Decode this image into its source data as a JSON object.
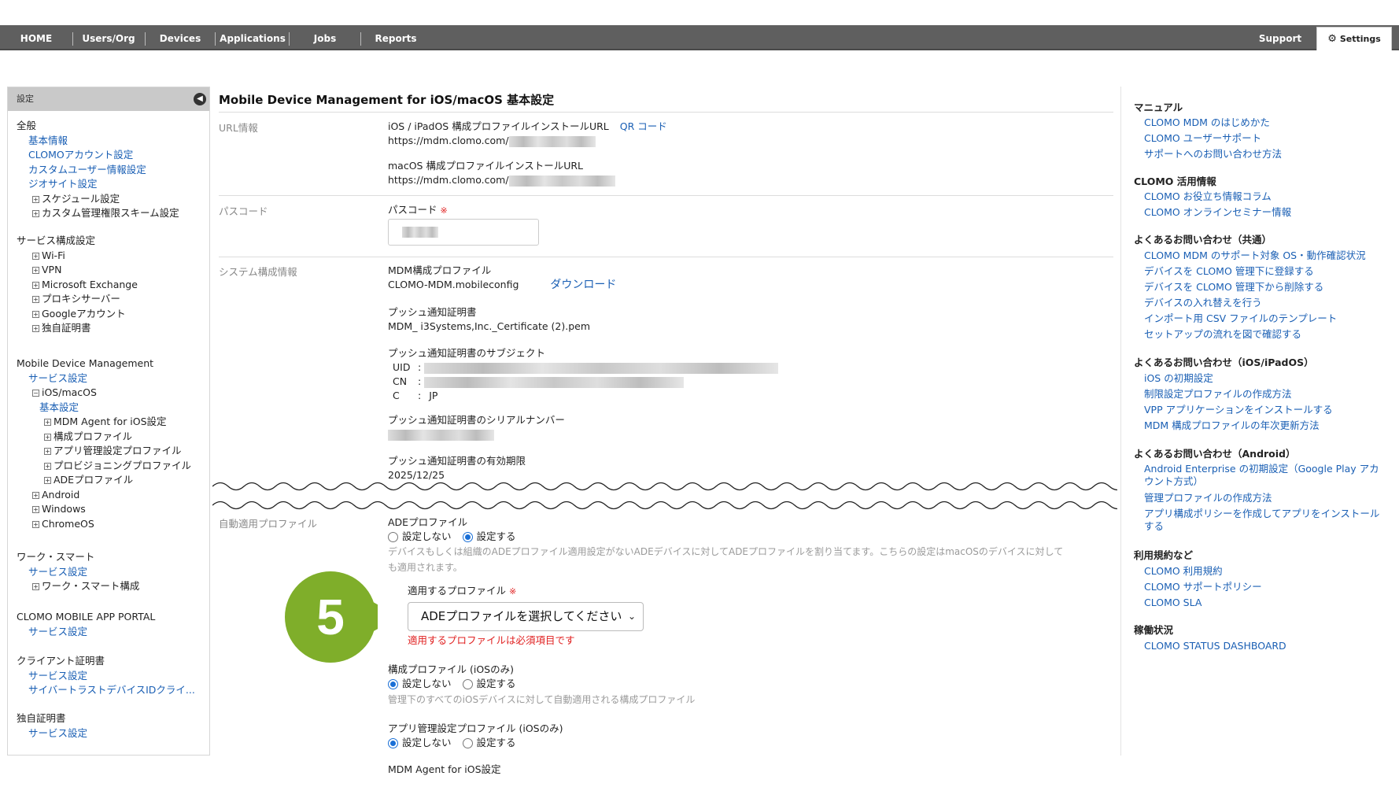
{
  "topnav": {
    "items": [
      "HOME",
      "Users/Org",
      "Devices",
      "Applications",
      "Jobs",
      "Reports"
    ],
    "support": "Support",
    "settings": "Settings"
  },
  "sidebar": {
    "header": "設定",
    "general": {
      "title": "全般",
      "links": [
        "基本情報",
        "CLOMOアカウント設定",
        "カスタムユーザー情報設定",
        "ジオサイト設定"
      ],
      "tree": [
        "スケジュール設定",
        "カスタム管理権限スキーム設定"
      ]
    },
    "service": {
      "title": "サービス構成設定",
      "tree": [
        "Wi-Fi",
        "VPN",
        "Microsoft Exchange",
        "プロキシサーバー",
        "Googleアカウント",
        "独自証明書"
      ]
    },
    "mdm": {
      "title": "Mobile Device Management",
      "service_link": "サービス設定",
      "ios": "iOS/macOS",
      "basic": "基本設定",
      "ios_children": [
        "MDM Agent for iOS設定",
        "構成プロファイル",
        "アプリ管理設定プロファイル",
        "プロビジョニングプロファイル",
        "ADEプロファイル"
      ],
      "others": [
        "Android",
        "Windows",
        "ChromeOS"
      ]
    },
    "work": {
      "title": "ワーク・スマート",
      "link": "サービス設定",
      "tree": "ワーク・スマート構成"
    },
    "portal": {
      "title": "CLOMO MOBILE APP PORTAL",
      "link": "サービス設定"
    },
    "client_cert": {
      "title": "クライアント証明書",
      "links": [
        "サービス設定",
        "サイバートラストデバイスIDクライ..."
      ]
    },
    "own_cert": {
      "title": "独自証明書",
      "link": "サービス設定"
    }
  },
  "main": {
    "title": "Mobile Device Management for iOS/macOS 基本設定",
    "url": {
      "label": "URL情報",
      "ios_title": "iOS / iPadOS 構成プロファイルインストールURL",
      "qr": "QR コード",
      "ios_url": "https://mdm.clomo.com/",
      "mac_title": "macOS 構成プロファイルインストールURL",
      "mac_url": "https://mdm.clomo.com/"
    },
    "passcode": {
      "label": "パスコード",
      "field_label": "パスコード",
      "required": "※"
    },
    "system": {
      "label": "システム構成情報",
      "mdm_profile": "MDM構成プロファイル",
      "mdm_file": "CLOMO-MDM.mobileconfig",
      "download": "ダウンロード",
      "push_cert": "プッシュ通知証明書",
      "push_file": "MDM_ i3Systems,Inc._Certificate (2).pem",
      "subject": "プッシュ通知証明書のサブジェクト",
      "uid": "UID",
      "cn": "CN",
      "c": "C",
      "c_val": "JP",
      "serial": "プッシュ通知証明書のシリアルナンバー",
      "expiry": "プッシュ通知証明書の有効期限",
      "expiry_val": "2025/12/25"
    },
    "auto": {
      "label": "自動適用プロファイル",
      "ade_title": "ADEプロファイル",
      "no": "設定しない",
      "yes": "設定する",
      "ade_help_1": "デバイスもしくは組織のADEプロファイル適用設定がないADEデバイスに対してADEプロファイルを割り当てます。こちらの設定はmacOSのデバイスに対して",
      "ade_help_2": "も適用されます。",
      "apply_label": "適用するプロファイル",
      "required": "※",
      "select_value": "ADEプロファイルを選択してください",
      "error": "適用するプロファイルは必須項目です",
      "config_title": "構成プロファイル (iOSのみ)",
      "config_help": "管理下のすべてのiOSデバイスに対して自動適用される構成プロファイル",
      "app_title": "アプリ管理設定プロファイル (iOSのみ)",
      "agent_title": "MDM Agent for iOS設定"
    },
    "step_number": "5"
  },
  "rightbar": {
    "manual": {
      "title": "マニュアル",
      "links": [
        "CLOMO MDM のはじめかた",
        "CLOMO ユーザーサポート",
        "サポートへのお問い合わせ方法"
      ]
    },
    "usage": {
      "title": "CLOMO 活用情報",
      "links": [
        "CLOMO お役立ち情報コラム",
        "CLOMO オンラインセミナー情報"
      ]
    },
    "faq_common": {
      "title": "よくあるお問い合わせ（共通）",
      "links": [
        "CLOMO MDM のサポート対象 OS・動作確認状況",
        "デバイスを CLOMO 管理下に登録する",
        "デバイスを CLOMO 管理下から削除する",
        "デバイスの入れ替えを行う",
        "インポート用 CSV ファイルのテンプレート",
        "セットアップの流れを図で確認する"
      ]
    },
    "faq_ios": {
      "title": "よくあるお問い合わせ（iOS/iPadOS）",
      "links": [
        "iOS の初期設定",
        "制限設定プロファイルの作成方法",
        "VPP アプリケーションをインストールする",
        "MDM 構成プロファイルの年次更新方法"
      ]
    },
    "faq_android": {
      "title": "よくあるお問い合わせ（Android）",
      "links": [
        "Android Enterprise の初期設定（Google Play アカウント方式）",
        "管理プロファイルの作成方法",
        "アプリ構成ポリシーを作成してアプリをインストールする"
      ]
    },
    "terms": {
      "title": "利用規約など",
      "links": [
        "CLOMO 利用規約",
        "CLOMO サポートポリシー",
        "CLOMO SLA"
      ]
    },
    "status": {
      "title": "稼働状況",
      "links": [
        "CLOMO STATUS DASHBOARD"
      ]
    }
  }
}
